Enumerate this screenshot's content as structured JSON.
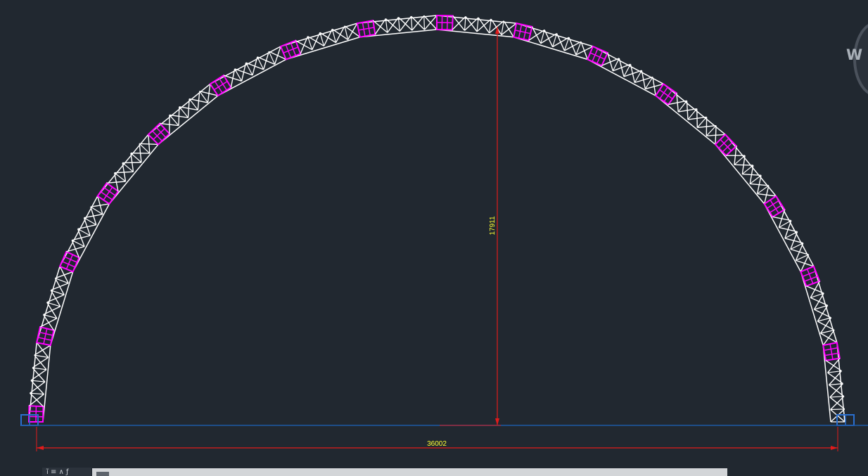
{
  "drawing": {
    "span_dimension": "36002",
    "rise_dimension": "17911",
    "truss_segments": 16,
    "colors": {
      "background": "#212830",
      "truss": "#ffffff",
      "joints": "#ff00ff",
      "supports": "#2a6fd0",
      "base_line": "#1e5aa8",
      "dimension_line": "#e21b1b",
      "dimension_text": "#ffff33"
    }
  },
  "viewcube": {
    "label": "W"
  },
  "command_line": {
    "text": "ĩ ≡ ∧ ƒ"
  }
}
